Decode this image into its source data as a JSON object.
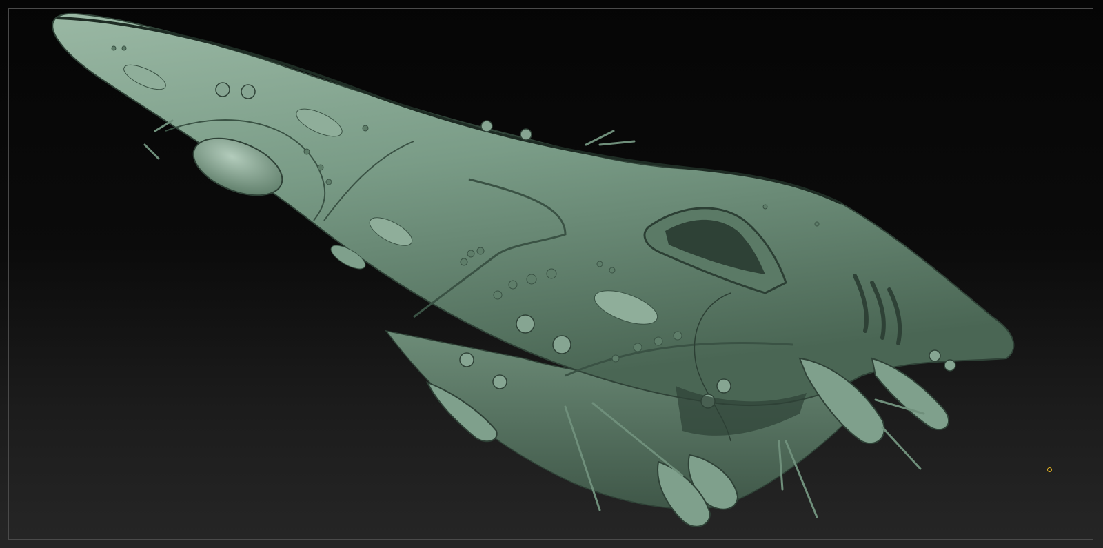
{
  "viewport": {
    "background_top": "#050505",
    "background_bottom": "#262626",
    "frame_color": "#4a4a4a"
  },
  "model": {
    "icon": "sculpted-spaceship-model",
    "material_color": "#7fa08c",
    "shadow_color": "#3d5446",
    "highlight_color": "#b4cdbd"
  },
  "cursor": {
    "icon": "brush-cursor-icon",
    "color": "#e0b020"
  }
}
